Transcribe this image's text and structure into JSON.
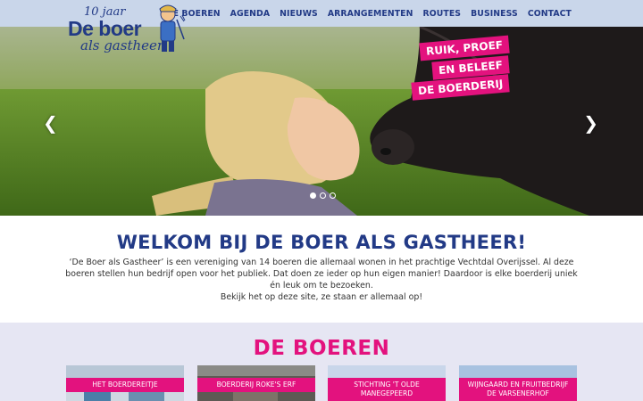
{
  "logo": {
    "years": "10 jaar",
    "brand_line1": "De boer",
    "brand_line2": "als gastheer"
  },
  "nav": [
    {
      "label": "DE BOEREN"
    },
    {
      "label": "AGENDA"
    },
    {
      "label": "NIEUWS"
    },
    {
      "label": "ARRANGEMENTEN"
    },
    {
      "label": "ROUTES"
    },
    {
      "label": "BUSINESS"
    },
    {
      "label": "CONTACT"
    }
  ],
  "hero": {
    "tagline": [
      "RUIK, PROEF",
      "EN BELEEF",
      "DE BOERDERIJ"
    ],
    "prev_icon": "chevron-left-icon",
    "next_icon": "chevron-right-icon",
    "slides_total": 3,
    "active_slide": 1
  },
  "welcome": {
    "title": "WELKOM BIJ DE BOER ALS GASTHEER!",
    "text": "‘De Boer als Gastheer’ is een vereniging van 14 boeren die allemaal wonen in het prachtige Vechtdal Overijssel. Al deze boeren stellen hun bedrijf open voor het publiek. Dat doen ze ieder op hun eigen manier! Daardoor is elke boerderij uniek én leuk om te bezoeken.",
    "text2": "Bekijk het op deze site, ze staan er allemaal op!"
  },
  "boeren": {
    "title": "DE BOEREN",
    "cards": [
      {
        "label": "HET BOERDEREITJE"
      },
      {
        "label": "BOERDERIJ ROKE'S ERF"
      },
      {
        "label": "STICHTING 'T OLDE MANEGEPEERD"
      },
      {
        "label": "WIJNGAARD EN FRUITBEDRIJF DE VARSENERHOF"
      }
    ]
  },
  "colors": {
    "primary": "#223a86",
    "accent": "#e3127e",
    "header_bg": "#c9d6ea",
    "section_bg": "#e6e6f3"
  }
}
